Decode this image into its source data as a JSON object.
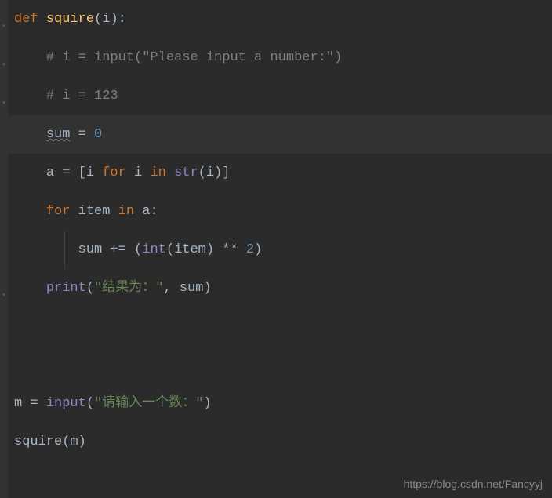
{
  "code": {
    "line1": {
      "def": "def",
      "fname": "squire",
      "lparen": "(",
      "param": "i",
      "rparen": ")",
      "colon": ":"
    },
    "line2": {
      "indent": "    ",
      "comment": "# i = input(\"Please input a number:\")"
    },
    "line3": {
      "indent": "    ",
      "comment": "# i = 123"
    },
    "line4": {
      "indent": "    ",
      "sum": "sum",
      "eq": " = ",
      "zero": "0"
    },
    "line5": {
      "indent": "    ",
      "a": "a",
      "eq": " = ",
      "lbrack": "[",
      "i1": "i",
      "for": "for",
      "i2": "i",
      "in": "in",
      "str": "str",
      "lparen": "(",
      "i3": "i",
      "rparen": ")",
      "rbrack": "]"
    },
    "line6": {
      "indent": "    ",
      "for": "for",
      "item": "item",
      "in": "in",
      "a": "a",
      "colon": ":"
    },
    "line7": {
      "indent": "        ",
      "sum": "sum",
      "pluseq": " += ",
      "lparen": "(",
      "int": "int",
      "lparen2": "(",
      "item": "item",
      "rparen2": ")",
      "pow": " ** ",
      "two": "2",
      "rparen": ")"
    },
    "line8": {
      "indent": "    ",
      "print": "print",
      "lparen": "(",
      "str": "\"结果为：\"",
      "comma": ", ",
      "sum": "sum",
      "rparen": ")"
    },
    "line9": {
      "m": "m",
      "eq": " = ",
      "input": "input",
      "lparen": "(",
      "str": "\"请输入一个数：\"",
      "rparen": ")"
    },
    "line10": {
      "fn": "squire",
      "lparen": "(",
      "m": "m",
      "rparen": ")"
    }
  },
  "watermark": "https://blog.csdn.net/Fancyyj"
}
